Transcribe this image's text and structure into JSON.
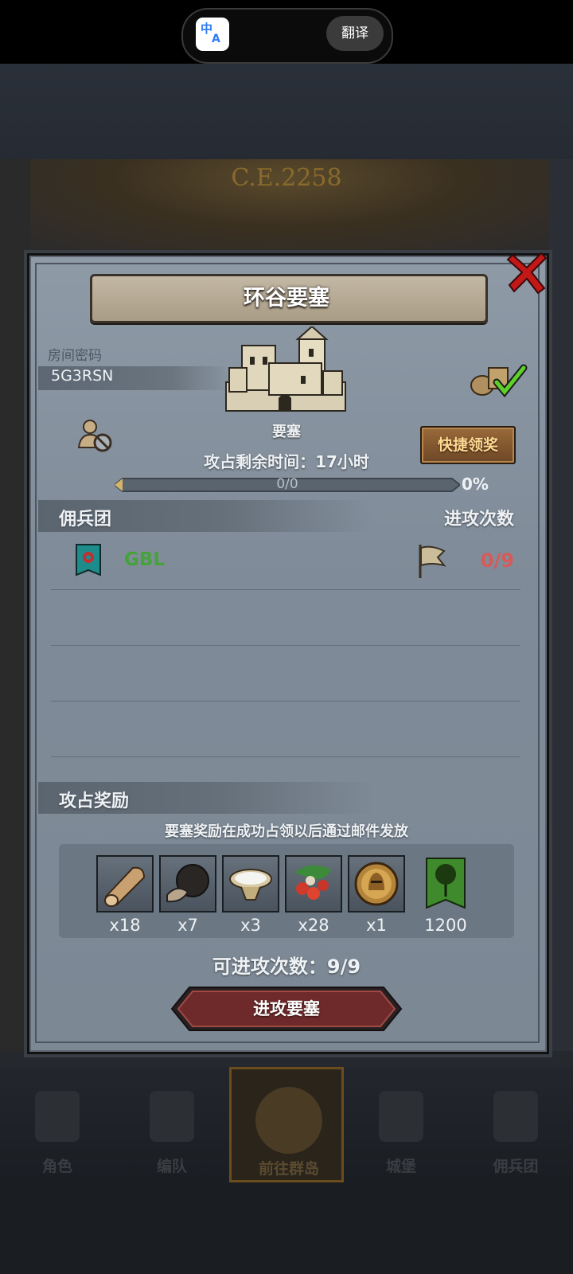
{
  "system": {
    "translate_label": "翻译",
    "translate_app_glyph": "中",
    "translate_app_glyph2": "A"
  },
  "background": {
    "year_text": "C.E.2258"
  },
  "modal": {
    "title": "环谷要塞",
    "room_password_label": "房间密码",
    "room_password": "5G3RSN",
    "building_name": "要塞",
    "quick_claim_button": "快捷领奖",
    "timer_text": "攻占剩余时间：17小时",
    "progress_fraction": "0/0",
    "progress_percent": "0%",
    "progress_value": 0,
    "mercenary_header": "佣兵团",
    "attack_count_header": "进攻次数",
    "guild": {
      "name": "GBL",
      "attacks": "0/9"
    },
    "rewards_header": "攻占奖励",
    "rewards_note": "要塞奖励在成功占领以后通过邮件发放",
    "rewards": [
      {
        "icon": "wood-log-icon",
        "qty": "x18"
      },
      {
        "icon": "truffle-icon",
        "qty": "x7"
      },
      {
        "icon": "salt-bowl-icon",
        "qty": "x3"
      },
      {
        "icon": "berries-icon",
        "qty": "x28"
      },
      {
        "icon": "knight-medal-icon",
        "qty": "x1"
      },
      {
        "icon": "green-tree-banner-icon",
        "qty": "1200"
      }
    ],
    "attacks_available": "可进攻次数：9/9",
    "attack_button": "进攻要塞"
  },
  "bottom_nav": [
    {
      "label": "角色",
      "icon": "knight-helmet-icon"
    },
    {
      "label": "编队",
      "icon": "armored-knight-icon"
    },
    {
      "label": "前往群岛",
      "icon": "compass-icon"
    },
    {
      "label": "城堡",
      "icon": "castle-icon"
    },
    {
      "label": "佣兵团",
      "icon": "warship-icon"
    }
  ],
  "colors": {
    "guild_name": "#46a23a",
    "attacks_red": "#d85a58",
    "quick_button_text": "#ffd890",
    "attack_button_bg": "#6e2a2a"
  }
}
